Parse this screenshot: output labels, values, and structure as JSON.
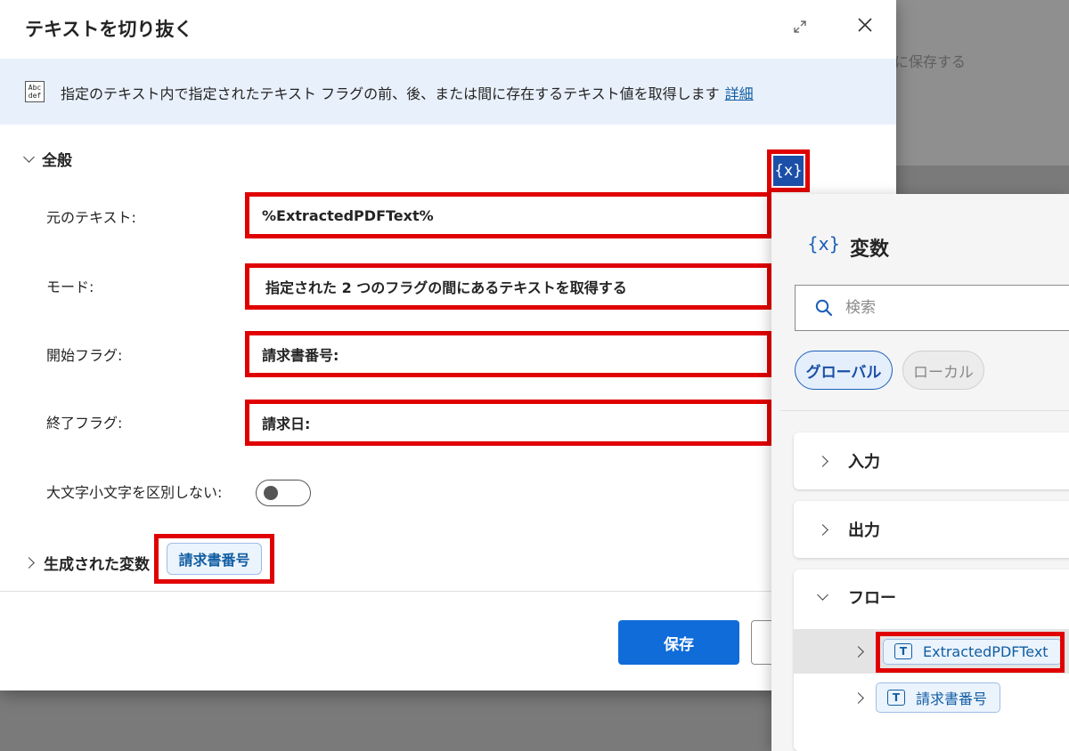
{
  "backdrop": {
    "text": "に保存する"
  },
  "dialog": {
    "title": "テキストを切り抜く",
    "info": {
      "icon_text": "Abc def",
      "description": "指定のテキスト内で指定されたテキスト フラグの前、後、または間に存在するテキスト値を取得します",
      "link": "詳細"
    },
    "section_general": "全般",
    "var_button_label": "{x}",
    "fields": {
      "source_text": {
        "label": "元のテキスト:",
        "value": "%ExtractedPDFText%"
      },
      "mode": {
        "label": "モード:",
        "value": "指定された 2 つのフラグの間にあるテキストを取得する"
      },
      "start_flag": {
        "label": "開始フラグ:",
        "value": "請求書番号:"
      },
      "end_flag": {
        "label": "終了フラグ:",
        "value": "請求日:"
      },
      "ignore_case": {
        "label": "大文字小文字を区別しない:",
        "value": false
      }
    },
    "generated_vars": {
      "label": "生成された変数",
      "chip": "請求書番号"
    },
    "save_label": "保存"
  },
  "variables_pane": {
    "icon": "{x}",
    "title": "変数",
    "search_placeholder": "検索",
    "filters": {
      "global": "グローバル",
      "local": "ローカル"
    },
    "groups": {
      "input": "入力",
      "output": "出力",
      "flow": "フロー"
    },
    "flow_items": [
      {
        "name": "ExtractedPDFText",
        "type_icon": "T"
      },
      {
        "name": "請求書番号",
        "type_icon": "T"
      }
    ]
  }
}
